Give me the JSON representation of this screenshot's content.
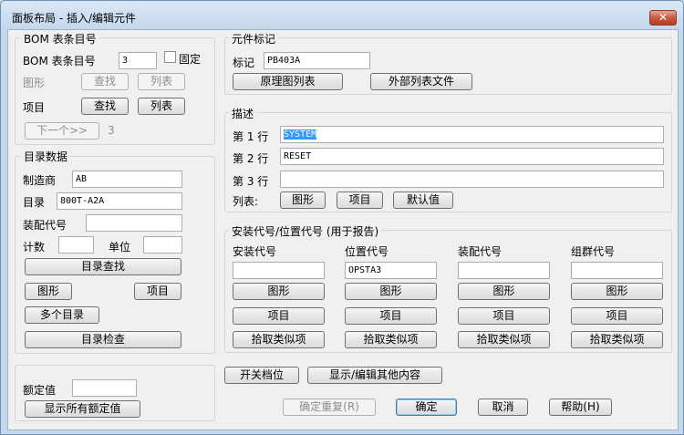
{
  "window": {
    "title": "面板布局 - 插入/编辑元件",
    "close_label": "✕"
  },
  "bom": {
    "group_title": "BOM 表条目号",
    "item_label": "BOM 表条目号",
    "item_value": "3",
    "fixed_label": "固定",
    "drawing_label": "图形",
    "find_button": "查找",
    "list_button": "列表",
    "project_label": "项目",
    "project_find_button": "查找",
    "project_list_button": "列表",
    "next_button": "下一个>>",
    "next_value": "3"
  },
  "catalog": {
    "group_title": "目录数据",
    "manufacturer_label": "制造商",
    "manufacturer_value": "AB",
    "catalog_label": "目录",
    "catalog_value": "800T-A2A",
    "assembly_label": "装配代号",
    "assembly_value": "",
    "count_label": "计数",
    "count_value": "",
    "unit_label": "单位",
    "unit_value": "",
    "lookup_button": "目录查找",
    "drawing_button": "图形",
    "project_button": "项目",
    "multi_button": "多个目录",
    "check_button": "目录检查"
  },
  "rating": {
    "label": "额定值",
    "value": "",
    "show_all_button": "显示所有额定值"
  },
  "tag": {
    "group_title": "元件标记",
    "label": "标记",
    "value": "PB403A",
    "schematic_list_button": "原理图列表",
    "external_list_button": "外部列表文件"
  },
  "description": {
    "group_title": "描述",
    "line1_label": "第 1 行",
    "line1_value": "SYSTEM",
    "line2_label": "第 2 行",
    "line2_value": "RESET",
    "line3_label": "第 3 行",
    "line3_value": "",
    "list_label": "列表:",
    "drawing_button": "图形",
    "project_button": "项目",
    "default_button": "默认值"
  },
  "location": {
    "group_title": "安装代号/位置代号 (用于报告)",
    "columns": [
      {
        "header": "安装代号",
        "value": "",
        "drawing": "图形",
        "project": "项目",
        "pick": "拾取类似项"
      },
      {
        "header": "位置代号",
        "value": "OPSTA3",
        "drawing": "图形",
        "project": "项目",
        "pick": "拾取类似项"
      },
      {
        "header": "装配代号",
        "value": "",
        "drawing": "图形",
        "project": "项目",
        "pick": "拾取类似项"
      },
      {
        "header": "组群代号",
        "value": "",
        "drawing": "图形",
        "project": "项目",
        "pick": "拾取类似项"
      }
    ]
  },
  "footer": {
    "switch_button": "开关档位",
    "show_edit_button": "显示/编辑其他内容",
    "ok_repeat_button": "确定重复(R)",
    "ok_button": "确定",
    "cancel_button": "取消",
    "help_button": "帮助(H)"
  }
}
